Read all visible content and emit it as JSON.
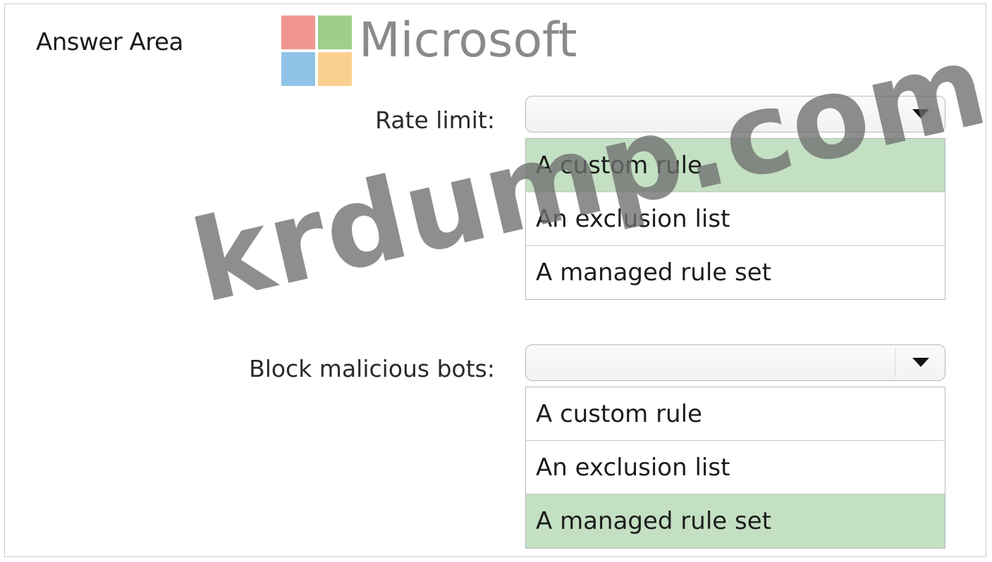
{
  "answer_area": {
    "title": "Answer Area"
  },
  "brand": {
    "wordmark": "Microsoft",
    "logo_colors": [
      "#f1968f",
      "#9dcf8a",
      "#8fc3e8",
      "#fbd08f"
    ]
  },
  "questions": [
    {
      "label": "Rate limit:",
      "selected_value": "",
      "options": [
        "A custom rule",
        "An exclusion list",
        "A managed rule set"
      ],
      "selected_index": 0
    },
    {
      "label": "Block malicious bots:",
      "selected_value": "",
      "options": [
        "A custom rule",
        "An exclusion list",
        "A managed rule set"
      ],
      "selected_index": 2
    }
  ],
  "watermark": {
    "text": "krdump.com"
  },
  "colors": {
    "selected_option_bg": "#c3e0c2",
    "border": "#b5b9bd"
  }
}
